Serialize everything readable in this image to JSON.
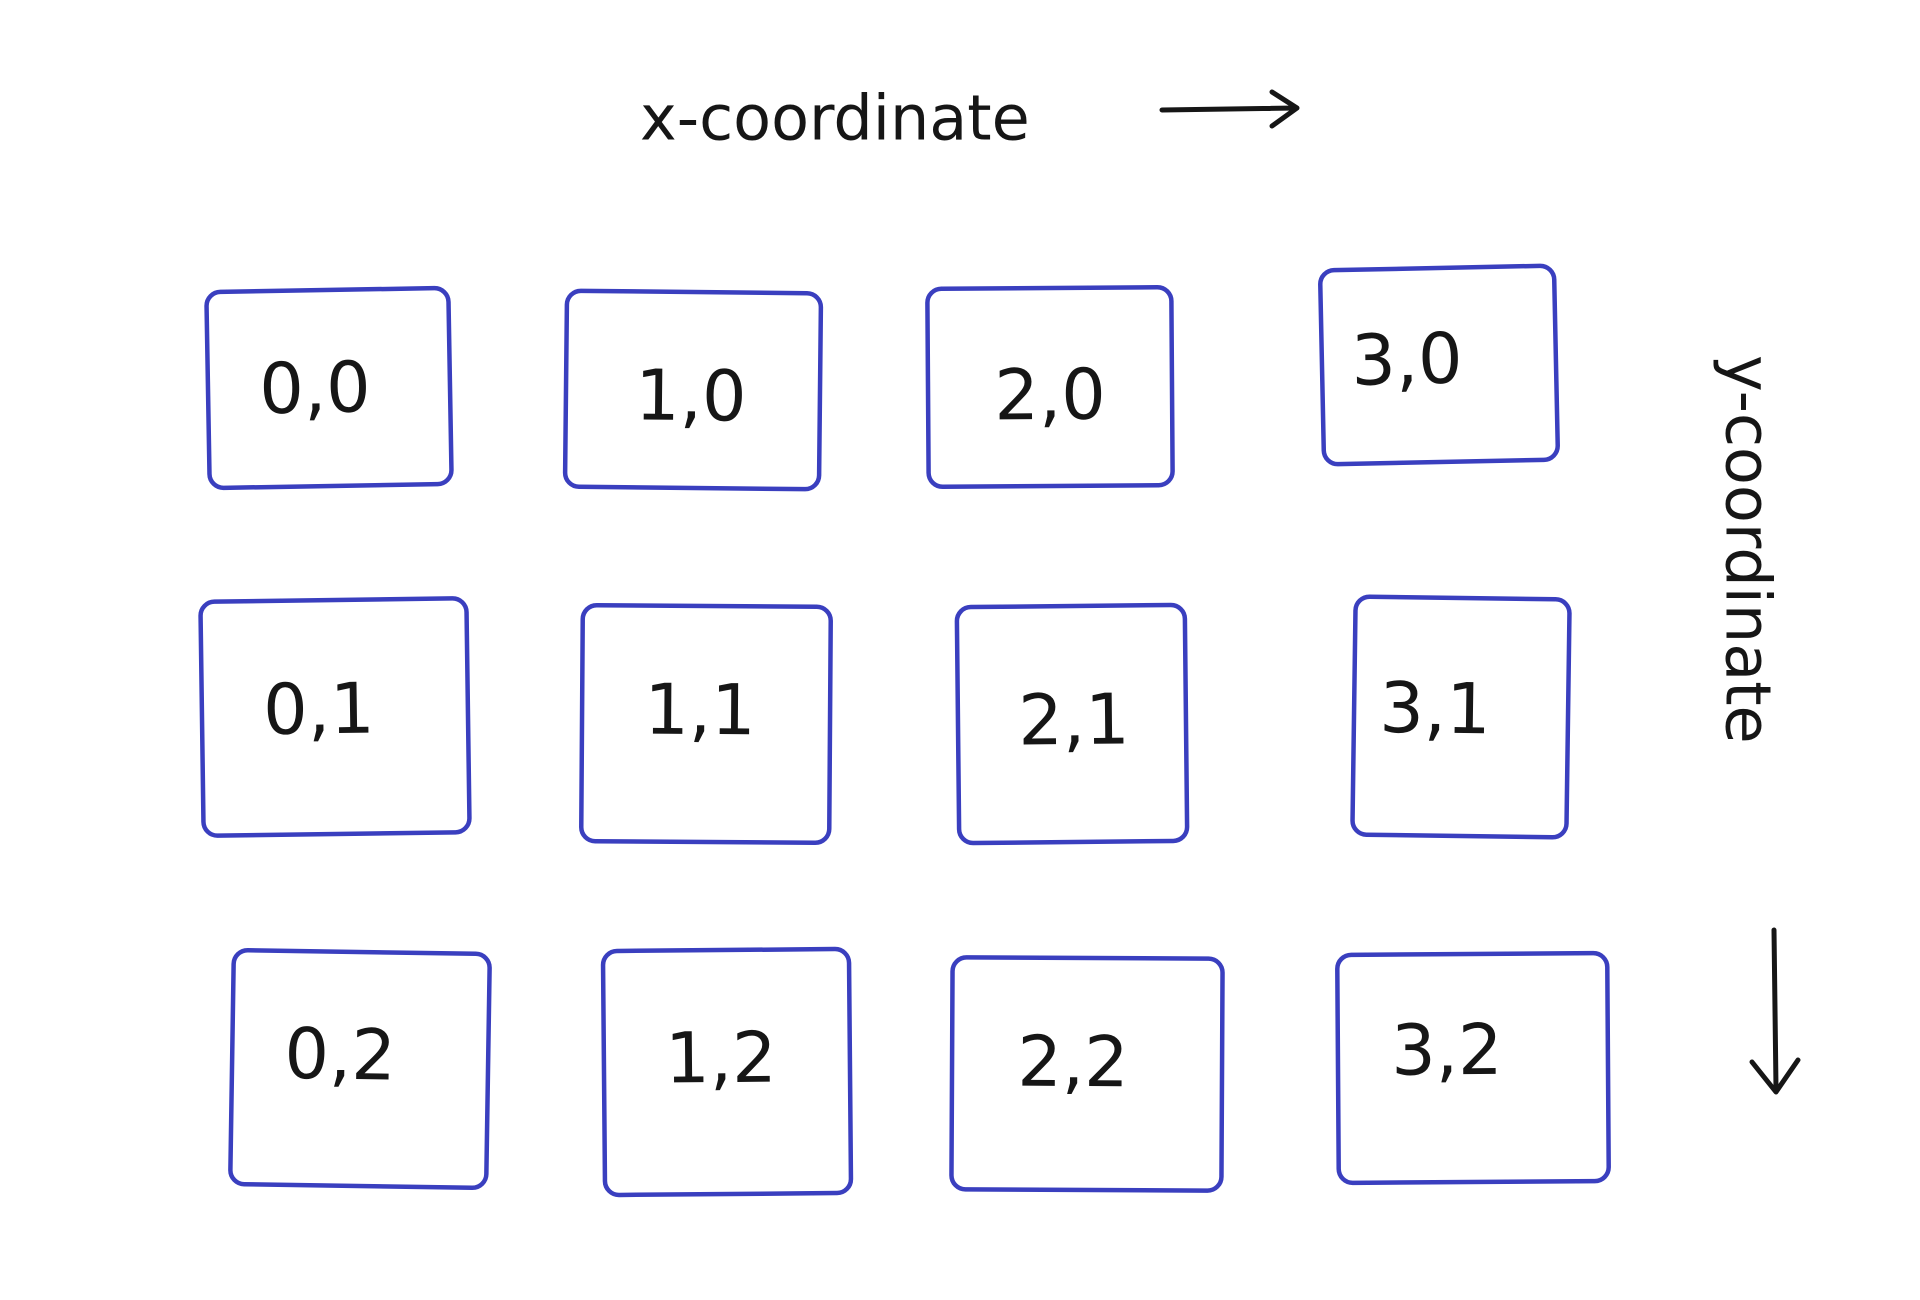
{
  "colors": {
    "box_stroke": "#3a3fbf",
    "ink": "#161616"
  },
  "x_axis": {
    "label": "x-coordinate",
    "direction": "right"
  },
  "y_axis": {
    "label": "y-coordinate",
    "direction": "down"
  },
  "grid": {
    "columns": 4,
    "rows": 3
  },
  "cells": [
    {
      "label": "0,0"
    },
    {
      "label": "1,0"
    },
    {
      "label": "2,0"
    },
    {
      "label": "3,0"
    },
    {
      "label": "0,1"
    },
    {
      "label": "1,1"
    },
    {
      "label": "2,1"
    },
    {
      "label": "3,1"
    },
    {
      "label": "0,2"
    },
    {
      "label": "1,2"
    },
    {
      "label": "2,2"
    },
    {
      "label": "3,2"
    }
  ]
}
